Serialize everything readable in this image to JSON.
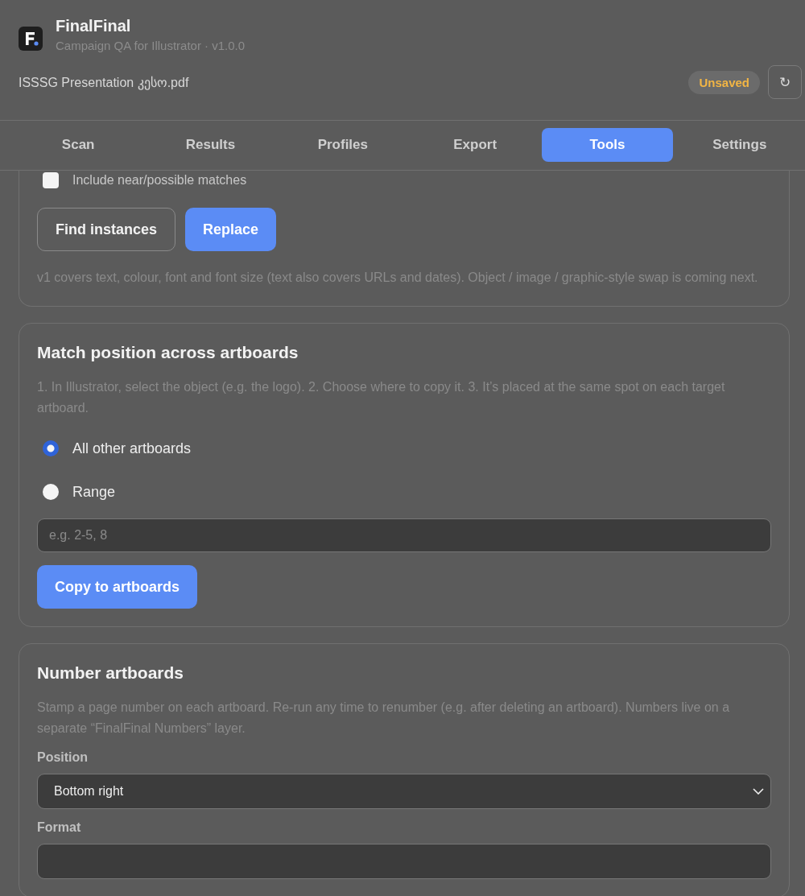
{
  "header": {
    "app_name": "FinalFinal",
    "subtitle": "Campaign QA for Illustrator · v1.0.0",
    "file_name": "ISSSG Presentation კესო.pdf",
    "status_badge": "Unsaved",
    "refresh_button": "↻"
  },
  "tabs": [
    {
      "label": "Scan",
      "selected": false
    },
    {
      "label": "Results",
      "selected": false
    },
    {
      "label": "Profiles",
      "selected": false
    },
    {
      "label": "Export",
      "selected": false
    },
    {
      "label": "Tools",
      "selected": true
    },
    {
      "label": "Settings",
      "selected": false
    }
  ],
  "find_replace": {
    "near_matches": {
      "label": "Include near/possible matches",
      "checked": false
    },
    "buttons": [
      {
        "label": "Find instances",
        "kind": "outline"
      },
      {
        "label": "Replace",
        "kind": "primary"
      }
    ],
    "note": "v1 covers text, colour, font and font size (text also covers URLs and dates). Object / image / graphic-style swap is coming next."
  },
  "match_position": {
    "title": "Match position across artboards",
    "description": "1. In Illustrator, select the object (e.g. the logo). 2. Choose where to copy it. 3. It’s placed at the same spot on each target artboard.",
    "options": [
      {
        "label": "All other artboards",
        "selected": true
      },
      {
        "label": "Range",
        "selected": false
      }
    ],
    "range_field": {
      "placeholder": "e.g. 2-5, 8"
    },
    "button": "Copy to artboards"
  },
  "number_artboards": {
    "title": "Number artboards",
    "description": "Stamp a page number on each artboard. Re-run any time to renumber (e.g. after deleting an artboard). Numbers live on a separate “FinalFinal Numbers” layer.",
    "position": {
      "label": "Position",
      "value": "Bottom right"
    },
    "format": {
      "label": "Format"
    }
  }
}
